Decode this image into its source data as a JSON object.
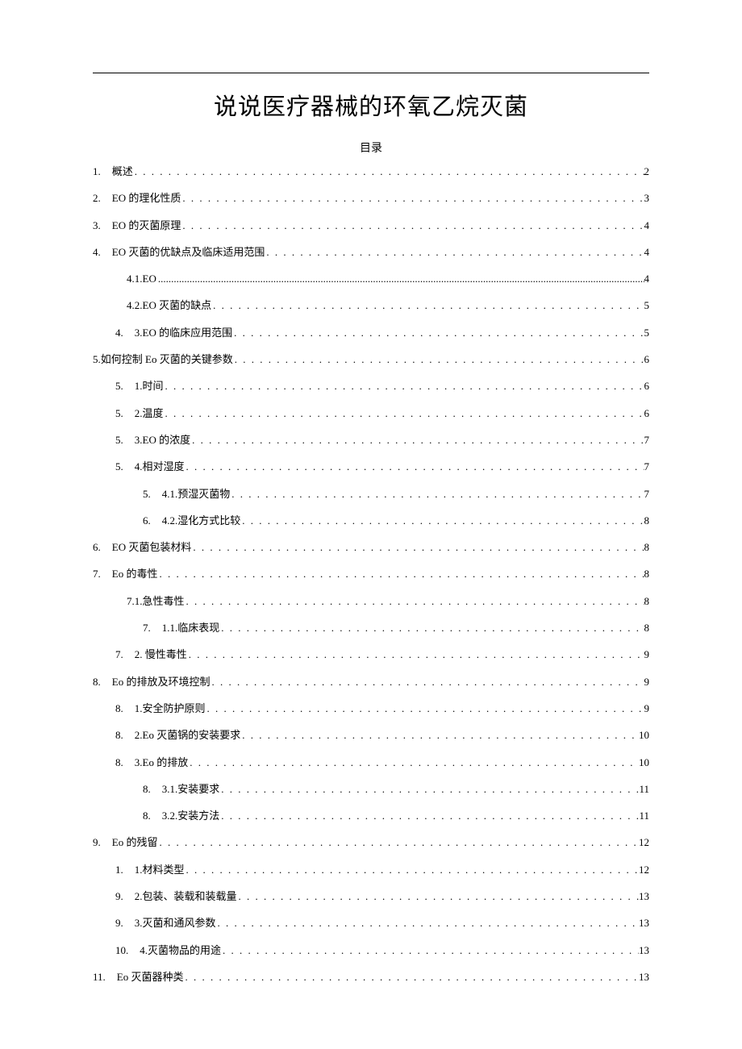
{
  "title": "说说医疗器械的环氧乙烷灭菌",
  "toc_label": "目录",
  "entries": [
    {
      "num": "1.",
      "text": "概述",
      "page": "2",
      "indent": 0
    },
    {
      "num": "2.",
      "text": "EO 的理化性质",
      "page": "3",
      "indent": 0
    },
    {
      "num": "3.",
      "text": "EO 的灭菌原理",
      "page": "4",
      "indent": 0
    },
    {
      "num": "4.",
      "text": "EO 灭菌的优缺点及临床适用范围",
      "page": "4",
      "indent": 0
    },
    {
      "num": "",
      "text": "4.1.EO",
      "page": "4",
      "indent": 1,
      "fine": true
    },
    {
      "num": "",
      "text": "4.2.EO 灭菌的缺点",
      "page": "5",
      "indent": 1
    },
    {
      "num": "4.",
      "text": "3.EO 的临床应用范围",
      "page": "5",
      "indent": 1
    },
    {
      "num": "",
      "text": "5.如何控制 Eo 灭菌的关键参数",
      "page": "6",
      "indent": 0,
      "nonum": true
    },
    {
      "num": "5.",
      "text": "1.时间",
      "page": "6",
      "indent": 1
    },
    {
      "num": "5.",
      "text": "2.温度",
      "page": "6",
      "indent": 1
    },
    {
      "num": "5.",
      "text": "3.EO 的浓度",
      "page": "7",
      "indent": 1
    },
    {
      "num": "5.",
      "text": "4.相对湿度",
      "page": "7",
      "indent": 1
    },
    {
      "num": "5.",
      "text": "4.1.预湿灭菌物",
      "page": "7",
      "indent": 2
    },
    {
      "num": "6.",
      "text": "4.2.湿化方式比较",
      "page": "8",
      "indent": 2
    },
    {
      "num": "6.",
      "text": "EO 灭菌包装材料",
      "page": "8",
      "indent": 0
    },
    {
      "num": "7.",
      "text": "Eo 的毒性",
      "page": "8",
      "indent": 0
    },
    {
      "num": "",
      "text": "7.1.急性毒性",
      "page": "8",
      "indent": 1
    },
    {
      "num": "7.",
      "text": "1.1.临床表现",
      "page": "8",
      "indent": 2
    },
    {
      "num": "7.",
      "text": "2. 慢性毒性",
      "page": "9",
      "indent": 1
    },
    {
      "num": "8.",
      "text": "Eo 的排放及环境控制",
      "page": "9",
      "indent": 0
    },
    {
      "num": "8.",
      "text": "1.安全防护原则",
      "page": "9",
      "indent": 1
    },
    {
      "num": "8.",
      "text": "2.Eo 灭菌锅的安装要求",
      "page": "10",
      "indent": 1
    },
    {
      "num": "8.",
      "text": "3.Eo 的排放",
      "page": "10",
      "indent": 1
    },
    {
      "num": "8.",
      "text": "3.1.安装要求",
      "page": "11",
      "indent": 2
    },
    {
      "num": "8.",
      "text": "3.2.安装方法",
      "page": "11",
      "indent": 2
    },
    {
      "num": "9.",
      "text": "Eo 的残留",
      "page": "12",
      "indent": 0
    },
    {
      "num": "1.",
      "text": "1.材料类型",
      "page": "12",
      "indent": 1
    },
    {
      "num": "9.",
      "text": "2.包装、装载和装载量",
      "page": "13",
      "indent": 1
    },
    {
      "num": "9.",
      "text": "3.灭菌和通风参数",
      "page": "13",
      "indent": 1
    },
    {
      "num": "10.",
      "text": "4.灭菌物品的用途",
      "page": "13",
      "indent": 1
    },
    {
      "num": "11.",
      "text": "Eo 灭菌器种类",
      "page": "13",
      "indent": 0
    }
  ]
}
